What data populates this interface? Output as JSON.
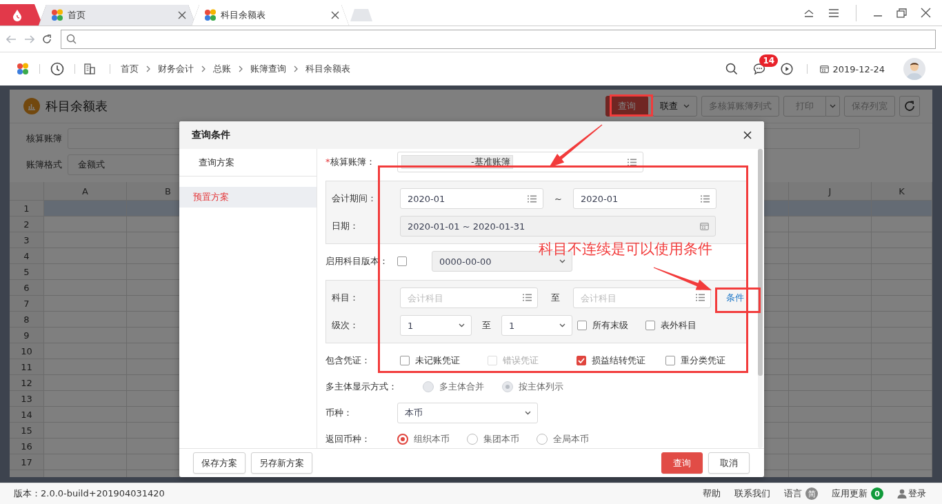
{
  "browser": {
    "tabs": [
      {
        "label": "首页",
        "selected": false
      },
      {
        "label": "科目余额表",
        "selected": true
      }
    ]
  },
  "app_header": {
    "breadcrumb": [
      "首页",
      "财务会计",
      "总账",
      "账簿查询",
      "科目余额表"
    ],
    "message_count": "14",
    "date": "2019-12-24"
  },
  "page": {
    "title": "科目余额表",
    "toolbar": [
      {
        "label": "查询",
        "kind": "primary",
        "disabled": false
      },
      {
        "label": "联查",
        "kind": "dropdown",
        "disabled": false
      },
      {
        "label": "多核算账簿列式",
        "kind": "plain",
        "disabled": true
      },
      {
        "label": "打印",
        "kind": "split",
        "disabled": true
      },
      {
        "label": "保存列宽",
        "kind": "plain",
        "disabled": true
      },
      {
        "kind": "refresh"
      }
    ],
    "filters": [
      {
        "label": "核算账簿"
      },
      {
        "label": "账簿格式",
        "value": "金额式"
      }
    ],
    "grid": {
      "columns": [
        "A",
        "B",
        "J",
        "K"
      ],
      "rows": [
        {
          "number": "1",
          "selected": true
        },
        {
          "number": "2",
          "selected": false
        },
        {
          "number": "3",
          "selected": false
        },
        {
          "number": "4",
          "selected": false
        },
        {
          "number": "5",
          "selected": false
        },
        {
          "number": "6",
          "selected": false
        },
        {
          "number": "7",
          "selected": false
        },
        {
          "number": "8",
          "selected": false
        },
        {
          "number": "9",
          "selected": false
        },
        {
          "number": "10",
          "selected": false
        },
        {
          "number": "11",
          "selected": false
        },
        {
          "number": "12",
          "selected": false
        },
        {
          "number": "13",
          "selected": false
        },
        {
          "number": "14",
          "selected": false
        },
        {
          "number": "15",
          "selected": false
        },
        {
          "number": "16",
          "selected": false
        },
        {
          "number": "17",
          "selected": false
        }
      ]
    }
  },
  "dialog": {
    "title": "查询条件",
    "schemes_heading": "查询方案",
    "schemes": [
      {
        "label": "预置方案",
        "selected": true
      }
    ],
    "form": {
      "ledger": {
        "required_mark": "*",
        "label": "核算账簿：",
        "tag": "-基准账簿"
      },
      "period": {
        "label": "会计期间：",
        "from": "2020-01",
        "separator": "~",
        "to": "2020-01"
      },
      "date": {
        "label": "日期：",
        "value": "2020-01-01 ~ 2020-01-31",
        "disabled": true
      },
      "version": {
        "label": "启用科目版本：",
        "checked": false,
        "value": "0000-00-00",
        "disabled": true
      },
      "subject": {
        "label": "科目：",
        "from_placeholder": "会计科目",
        "separator": "至",
        "to_placeholder": "会计科目",
        "link": "条件"
      },
      "level": {
        "label": "级次：",
        "from": "1",
        "separator": "至",
        "to": "1",
        "options": [
          {
            "label": "所有末级",
            "checked": false
          },
          {
            "label": "表外科目",
            "checked": false
          }
        ]
      },
      "vouchers": {
        "label": "包含凭证：",
        "options": [
          {
            "label": "未记账凭证",
            "checked": false,
            "disabled": false
          },
          {
            "label": "错误凭证",
            "checked": false,
            "disabled": true
          },
          {
            "label": "损益结转凭证",
            "checked": true,
            "disabled": false
          },
          {
            "label": "重分类凭证",
            "checked": false,
            "disabled": false
          }
        ]
      },
      "multi_entity": {
        "label": "多主体显示方式：",
        "options": [
          {
            "label": "多主体合并",
            "selected": false,
            "disabled": true
          },
          {
            "label": "按主体列示",
            "selected": true,
            "disabled": true
          }
        ]
      },
      "currency": {
        "label": "币种：",
        "value": "本币"
      },
      "return_currency": {
        "label": "返回币种：",
        "options": [
          {
            "label": "组织本币",
            "selected": true
          },
          {
            "label": "集团本币",
            "selected": false
          },
          {
            "label": "全局本币",
            "selected": false
          }
        ]
      }
    },
    "footer_left": [
      "保存方案",
      "另存新方案"
    ],
    "footer_right": [
      {
        "label": "查询",
        "kind": "primary"
      },
      {
        "label": "取消",
        "kind": "default"
      }
    ]
  },
  "annotations": {
    "note": "科目不连续是可以使用条件"
  },
  "status_bar": {
    "version": "版本：2.0.0-build+201904031420",
    "links": [
      "帮助",
      "联系我们"
    ],
    "language": {
      "label": "语言",
      "badge": "简"
    },
    "updates": {
      "label": "应用更新",
      "count": "0"
    },
    "login": "登录"
  }
}
